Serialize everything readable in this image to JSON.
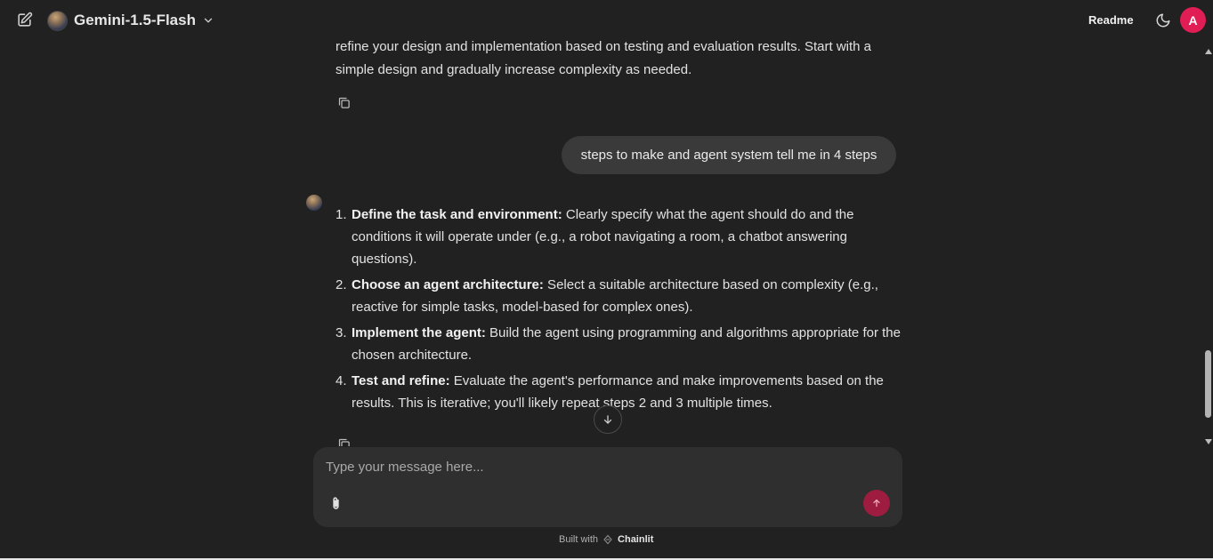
{
  "header": {
    "model_name": "Gemini-1.5-Flash",
    "readme_label": "Readme",
    "user_initial": "A"
  },
  "chat": {
    "prev_paragraph": "refine your design and implementation based on testing and evaluation results.  Start with a simple design and gradually increase complexity as needed.",
    "user_message": "steps to make and agent system tell me in 4 steps",
    "steps": [
      {
        "num": "1.",
        "title": "Define the task and environment:",
        "text": "  Clearly specify what the agent should do and the conditions it will operate under (e.g., a robot navigating a room, a chatbot answering questions)."
      },
      {
        "num": "2.",
        "title": "Choose an agent architecture:",
        "text": " Select a suitable architecture based on complexity (e.g., reactive for simple tasks, model-based for complex ones)."
      },
      {
        "num": "3.",
        "title": "Implement the agent:",
        "text": " Build the agent using programming and algorithms appropriate for the chosen architecture."
      },
      {
        "num": "4.",
        "title": "Test and refine:",
        "text": " Evaluate the agent's performance and make improvements based on the results.  This is iterative; you'll likely repeat steps 2 and 3 multiple times."
      }
    ]
  },
  "composer": {
    "placeholder": "Type your message here..."
  },
  "footer": {
    "built_with": "Built with",
    "brand": "Chainlit"
  },
  "colors": {
    "background": "#212121",
    "bubble": "#3a3a3a",
    "composer": "#2f2f2f",
    "accent": "#e11d55",
    "send_button": "#9d1c3f"
  },
  "icons": [
    "edit-icon",
    "chevron-down-icon",
    "moon-icon",
    "copy-icon",
    "arrow-down-icon",
    "paperclip-icon",
    "arrow-up-icon",
    "chainlit-logo-icon"
  ]
}
